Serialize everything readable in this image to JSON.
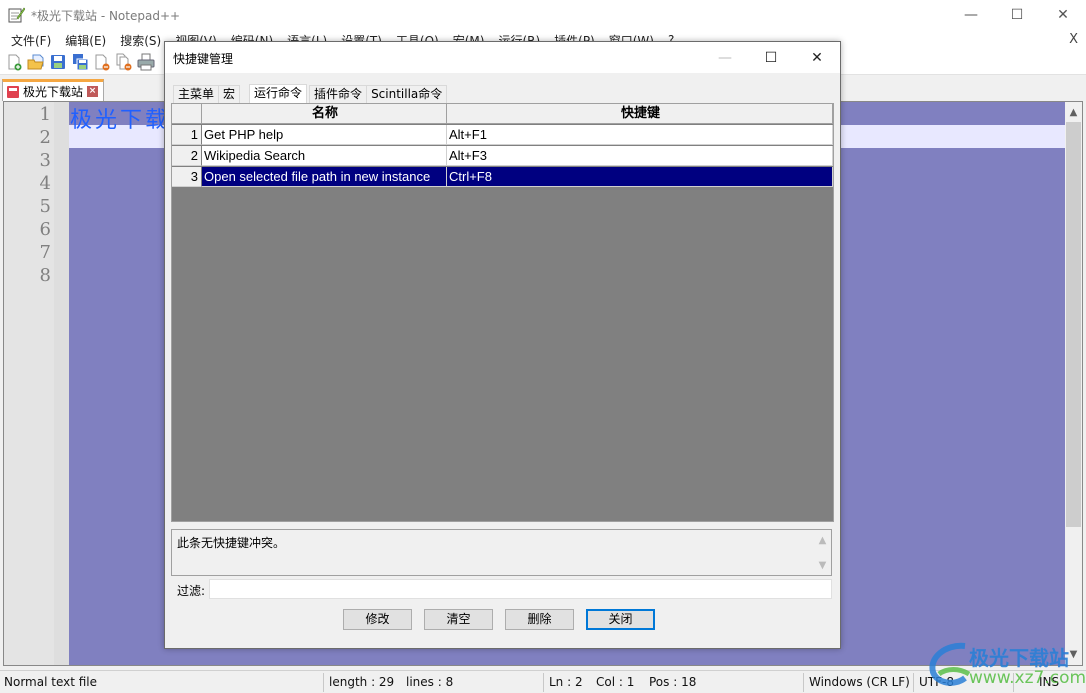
{
  "window": {
    "title": "*极光下载站 - Notepad++",
    "minimize": "—",
    "maximize": "☐",
    "close": "✕"
  },
  "menubar": {
    "items": [
      "文件(F)",
      "编辑(E)",
      "搜索(S)",
      "视图(V)",
      "编码(N)",
      "语言(L)",
      "设置(T)",
      "工具(O)",
      "宏(M)",
      "运行(R)",
      "插件(P)",
      "窗口(W)",
      "?"
    ],
    "close_doc": "X"
  },
  "toolbar": {
    "icons": [
      "new-file-icon",
      "open-file-icon",
      "save-icon",
      "save-all-icon",
      "close-icon",
      "close-all-icon",
      "print-icon"
    ]
  },
  "tabs": [
    {
      "label": "极光下载站",
      "modified": true
    }
  ],
  "editor": {
    "line_numbers": [
      "1",
      "2",
      "3",
      "4",
      "5",
      "6",
      "7",
      "8"
    ],
    "line1_text": "极光下载站",
    "bg_color": "#8080c0",
    "current_line_color": "#e8e8ff",
    "text_color": "#2060ff"
  },
  "dialog": {
    "title": "快捷键管理",
    "minimize": "—",
    "maximize": "☐",
    "close": "✕",
    "tabs": [
      "主菜单",
      "宏",
      "运行命令",
      "插件命令",
      "Scintilla命令"
    ],
    "active_tab": 2,
    "grid": {
      "headers": [
        "名称",
        "快捷键"
      ],
      "rows": [
        {
          "num": "1",
          "name": "Get PHP help",
          "shortcut": "Alt+F1"
        },
        {
          "num": "2",
          "name": "Wikipedia Search",
          "shortcut": "Alt+F3"
        },
        {
          "num": "3",
          "name": "Open selected file path in new instance",
          "shortcut": "Ctrl+F8",
          "selected": true
        }
      ],
      "selection_color": "#000080"
    },
    "conflict_text": "此条无快捷键冲突。",
    "filter_label": "过滤:",
    "filter_value": "",
    "buttons": {
      "modify": "修改",
      "clear": "清空",
      "delete": "删除",
      "close": "关闭"
    }
  },
  "statusbar": {
    "file_type": "Normal text file",
    "length": "length : 29",
    "lines": "lines : 8",
    "ln": "Ln : 2",
    "col": "Col : 1",
    "pos": "Pos : 18",
    "eol": "Windows (CR LF)",
    "encoding": "UTF-8",
    "mode": "INS"
  },
  "watermark": {
    "brand": "极光下载站",
    "url": "www.xz7.com"
  }
}
